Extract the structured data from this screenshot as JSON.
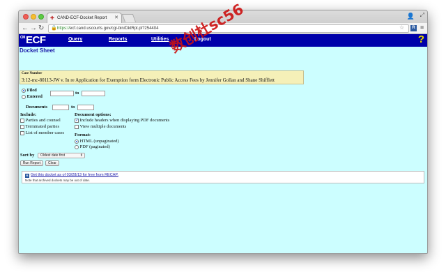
{
  "browser": {
    "tab_title": "CAND-ECF-Docket Report",
    "url_scheme": "https://",
    "url_rest": "ecf.cand.uscourts.gov/cgi-bin/DktRpt.pl?254404",
    "extension_badge": "R"
  },
  "ecf_nav": {
    "logo_prefix": "CM",
    "logo": "ECF",
    "items": [
      "Query",
      "Reports",
      "Utilities",
      "Logout"
    ],
    "help": "?"
  },
  "page": {
    "title": "Docket Sheet"
  },
  "case": {
    "label": "Case Number",
    "text": "3:12-mc-80113-JW v. In re Application for Exemption form Electronic Public Access Fees by Jennifer Gollan and Shane Shifflett"
  },
  "date_filter": {
    "filed_label": "Filed",
    "entered_label": "Entered",
    "to_label": "to",
    "selected": "Filed"
  },
  "documents": {
    "label": "Documents",
    "to_label": "to"
  },
  "include": {
    "heading": "Include:",
    "items": [
      {
        "label": "Parties and counsel",
        "checked": false
      },
      {
        "label": "Terminated parties",
        "checked": false
      },
      {
        "label": "List of member cases",
        "checked": false
      }
    ]
  },
  "document_options": {
    "heading": "Document options:",
    "items": [
      {
        "label": "Include headers when displaying PDF documents",
        "checked": true
      },
      {
        "label": "View multiple documents",
        "checked": false
      }
    ]
  },
  "format": {
    "heading": "Format:",
    "options": [
      {
        "label": "HTML (unpaginated)",
        "selected": true
      },
      {
        "label": "PDF (paginated)",
        "selected": false
      }
    ]
  },
  "sort": {
    "label": "Sort by",
    "value": "Oldest date first"
  },
  "buttons": {
    "run": "Run Report",
    "clear": "Clear"
  },
  "recap": {
    "icon": "R",
    "link": "Get this docket as of 03/28/13 for free from RECAP.",
    "note": "Note that archived dockets may be out of date."
  },
  "watermark": "数创杜sc56"
}
